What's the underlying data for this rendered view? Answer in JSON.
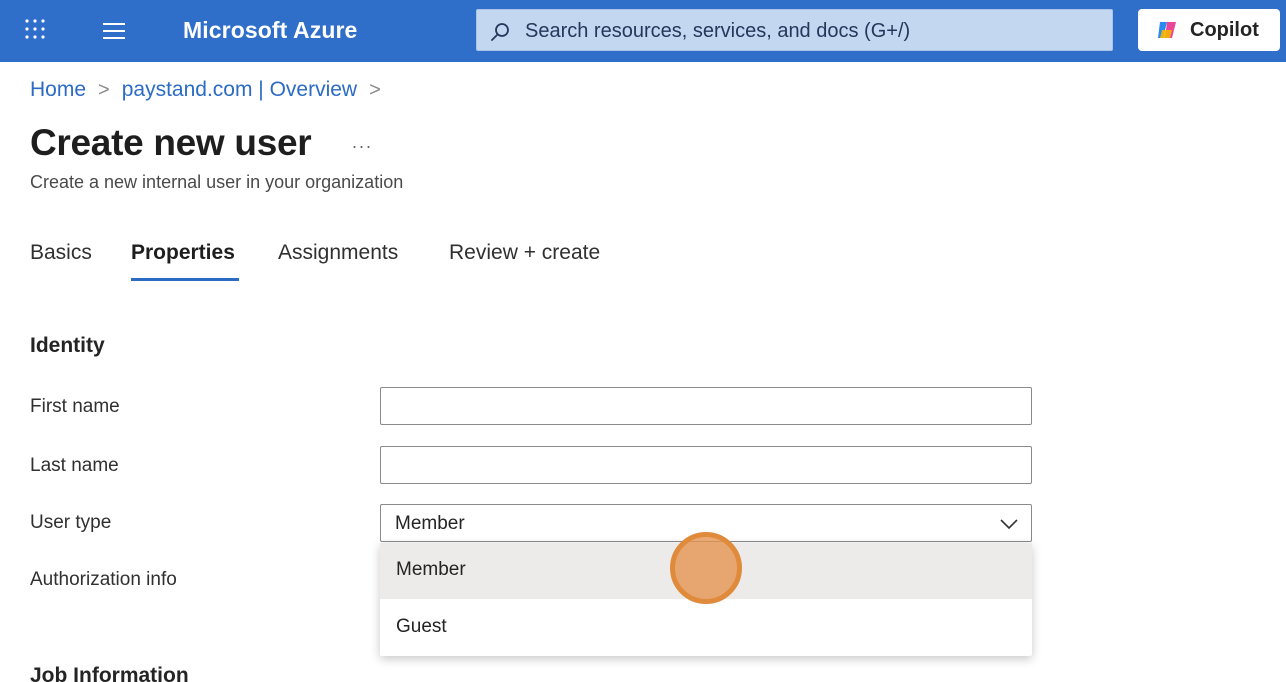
{
  "header": {
    "brand": "Microsoft Azure",
    "search_placeholder": "Search resources, services, and docs (G+/)",
    "copilot_label": "Copilot",
    "icons": [
      "waffle-icon",
      "hamburger-icon",
      "search-icon",
      "copilot-icon"
    ]
  },
  "breadcrumb": {
    "items": [
      "Home",
      "paystand.com | Overview"
    ]
  },
  "page": {
    "title": "Create new user",
    "more": "...",
    "subtitle": "Create a new internal user in your organization"
  },
  "tabs": [
    {
      "label": "Basics",
      "active": false
    },
    {
      "label": "Properties",
      "active": true
    },
    {
      "label": "Assignments",
      "active": false
    },
    {
      "label": "Review + create",
      "active": false
    }
  ],
  "identity": {
    "heading": "Identity",
    "first_name_label": "First name",
    "first_name_value": "",
    "last_name_label": "Last name",
    "last_name_value": "",
    "user_type_label": "User type",
    "user_type_value": "Member",
    "user_type_options": [
      "Member",
      "Guest"
    ],
    "authorization_label": "Authorization info"
  },
  "job_information": {
    "heading": "Job Information"
  },
  "colors": {
    "topbar": "#2f6fc9",
    "accent": "#2c6bc4",
    "cursor": "#e08a3c"
  }
}
